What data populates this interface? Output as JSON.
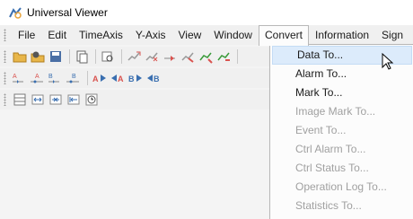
{
  "window": {
    "title": "Universal Viewer"
  },
  "menubar": {
    "items": [
      {
        "label": "File"
      },
      {
        "label": "Edit"
      },
      {
        "label": "TimeAxis"
      },
      {
        "label": "Y-Axis"
      },
      {
        "label": "View"
      },
      {
        "label": "Window"
      },
      {
        "label": "Convert",
        "state": "open"
      },
      {
        "label": "Information"
      },
      {
        "label": "Sign"
      }
    ]
  },
  "convert_menu": {
    "items": [
      {
        "label": "Data To...",
        "enabled": true,
        "highlighted": true
      },
      {
        "label": "Alarm To...",
        "enabled": true
      },
      {
        "label": "Mark To...",
        "enabled": true
      },
      {
        "label": "Image Mark To...",
        "enabled": false
      },
      {
        "label": "Event To...",
        "enabled": false
      },
      {
        "label": "Ctrl Alarm To...",
        "enabled": false
      },
      {
        "label": "Ctrl Status To...",
        "enabled": false
      },
      {
        "label": "Operation Log To...",
        "enabled": false
      },
      {
        "label": "Statistics To...",
        "enabled": false
      }
    ]
  },
  "toolbar_icons": {
    "row1": [
      "open-folder-icon",
      "open-recent-icon",
      "save-icon",
      "copy-icon",
      "print-preview-icon",
      "zoom-in-icon",
      "zoom-out-icon",
      "fit-icon",
      "zoom-range-icon",
      "zoom-reset-icon"
    ],
    "row2": [
      "cursor-a-icon",
      "cursor-ab-icon",
      "cursor-b-icon",
      "cursor-b-add-icon",
      "jump-a-icon",
      "jump-ka-icon",
      "jump-b-icon",
      "jump-kb-icon"
    ],
    "row3": [
      "layout-icon",
      "expand-axis-icon",
      "shrink-axis-icon",
      "move-start-icon",
      "clock-icon"
    ]
  },
  "colors": {
    "highlight_bg": "#dcebfb",
    "disabled_text": "#a0a0a0",
    "icon_orange": "#e8a33a",
    "icon_red": "#d9534f",
    "icon_blue": "#3a6fb0"
  }
}
